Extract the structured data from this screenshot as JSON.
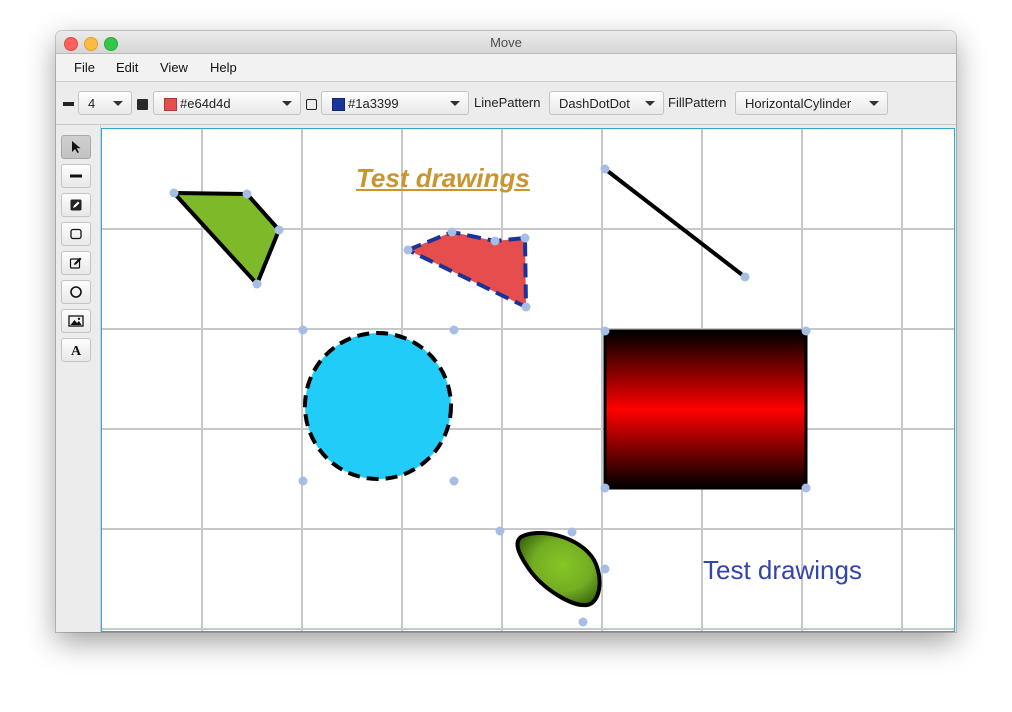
{
  "window": {
    "title": "Move"
  },
  "menu": [
    {
      "label": "File"
    },
    {
      "label": "Edit"
    },
    {
      "label": "View"
    },
    {
      "label": "Help"
    }
  ],
  "toolbar": {
    "line_width_icon": "line-width-icon",
    "line_width": {
      "value": "4"
    },
    "fill_color_icon": "filled-square-icon",
    "fill_color": {
      "value": "#e64d4d",
      "swatch": "#e64d4d"
    },
    "stroke_color_icon": "outline-square-icon",
    "stroke_color": {
      "value": "#1a3399",
      "swatch": "#1a3399"
    },
    "line_pattern_label": "LinePattern",
    "line_pattern": {
      "value": "DashDotDot"
    },
    "fill_pattern_label": "FillPattern",
    "fill_pattern": {
      "value": "HorizontalCylinder"
    }
  },
  "tools": [
    {
      "icon": "pointer-icon",
      "selected": true
    },
    {
      "icon": "line-tool-icon",
      "selected": false
    },
    {
      "icon": "pen-icon",
      "selected": false
    },
    {
      "icon": "rectangle-tool-icon",
      "selected": false
    },
    {
      "icon": "edit-icon",
      "selected": false
    },
    {
      "icon": "ellipse-tool-icon",
      "selected": false
    },
    {
      "icon": "image-tool-icon",
      "selected": false
    },
    {
      "icon": "text-tool-icon",
      "selected": false
    }
  ],
  "canvas": {
    "title_text": "Test drawings",
    "label_text": "Test drawings",
    "colors": {
      "grid": "#c8c8c8",
      "handle": "#a6bde4",
      "green_fill": "#7db928",
      "red_fill": "#e64d4d",
      "dash_stroke": "#1a3399",
      "circle_fill": "#22ccf8",
      "title": "#c8952f",
      "label": "#3344aa",
      "canvas_border": "#33a6d6"
    }
  }
}
